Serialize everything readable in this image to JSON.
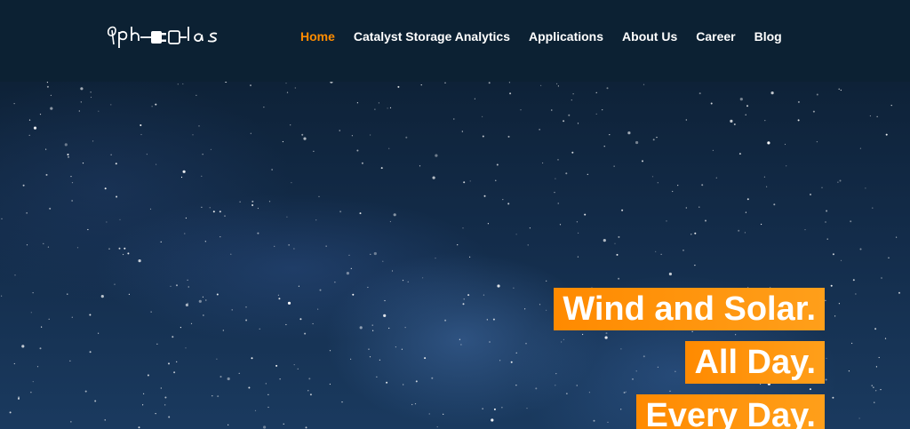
{
  "header": {
    "logo_text": "ph-las",
    "nav": [
      {
        "label": "Home",
        "active": true
      },
      {
        "label": "Catalyst Storage Analytics",
        "active": false
      },
      {
        "label": "Applications",
        "active": false
      },
      {
        "label": "About Us",
        "active": false
      },
      {
        "label": "Career",
        "active": false
      },
      {
        "label": "Blog",
        "active": false
      }
    ]
  },
  "hero": {
    "lines": [
      "Wind and Solar.",
      "All Day.",
      "Every Day."
    ]
  },
  "colors": {
    "header_bg": "#0c2133",
    "accent": "#ff8c00",
    "text": "#ffffff"
  }
}
